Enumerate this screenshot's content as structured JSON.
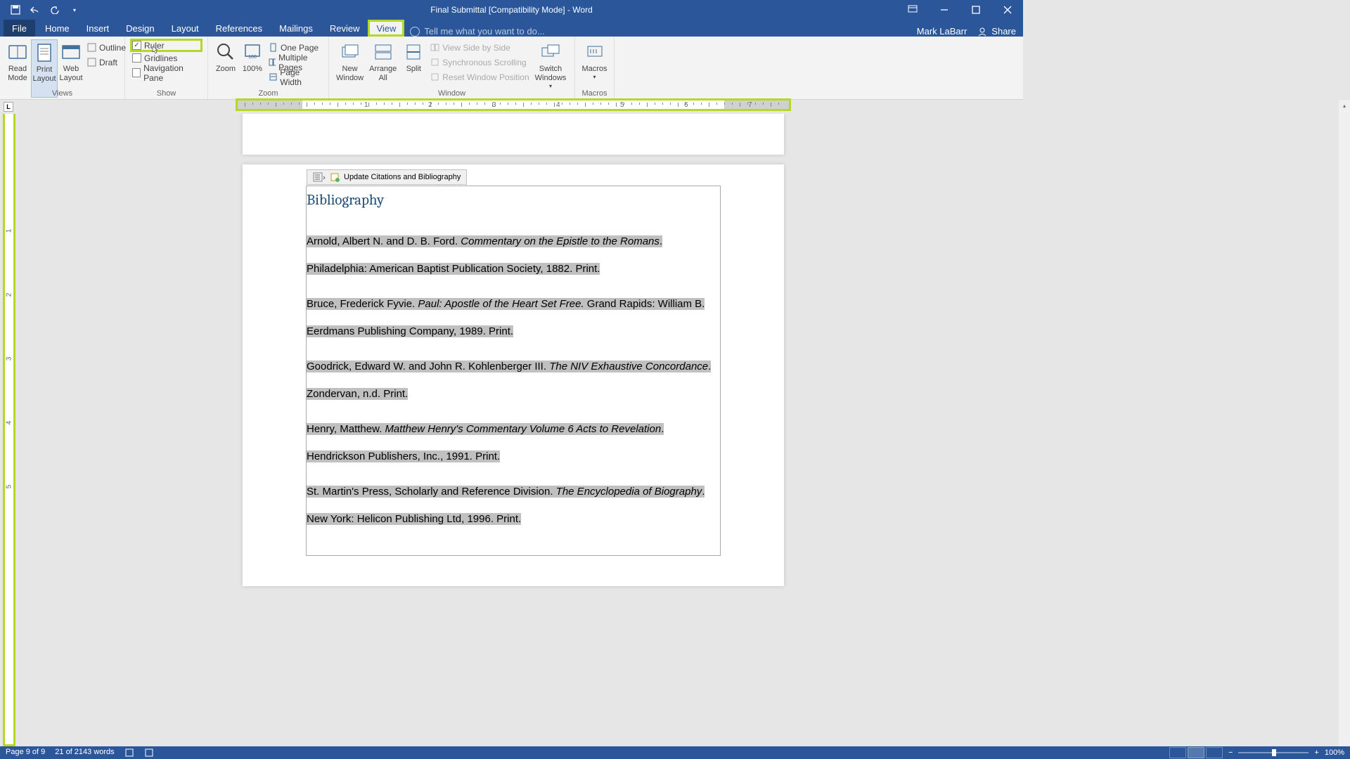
{
  "title_bar": {
    "doc_title": "Final Submittal [Compatibility Mode] - Word"
  },
  "tabs": {
    "file": "File",
    "items": [
      "Home",
      "Insert",
      "Design",
      "Layout",
      "References",
      "Mailings",
      "Review",
      "View"
    ],
    "active": "View",
    "tell_me": "Tell me what you want to do..."
  },
  "user": {
    "name": "Mark LaBarr",
    "share": "Share"
  },
  "ribbon": {
    "views": {
      "label": "Views",
      "read_mode": "Read\nMode",
      "print_layout": "Print\nLayout",
      "web_layout": "Web\nLayout",
      "outline": "Outline",
      "draft": "Draft"
    },
    "show": {
      "label": "Show",
      "ruler": "Ruler",
      "gridlines": "Gridlines",
      "nav_pane": "Navigation Pane"
    },
    "zoom": {
      "label": "Zoom",
      "zoom": "Zoom",
      "pct": "100%",
      "one_page": "One Page",
      "multi_pages": "Multiple Pages",
      "page_width": "Page Width"
    },
    "window": {
      "label": "Window",
      "new_window": "New\nWindow",
      "arrange_all": "Arrange\nAll",
      "split": "Split",
      "side_by_side": "View Side by Side",
      "sync_scroll": "Synchronous Scrolling",
      "reset_pos": "Reset Window Position",
      "switch": "Switch\nWindows"
    },
    "macros": {
      "label": "Macros",
      "macros": "Macros"
    }
  },
  "ruler": {
    "numbers": [
      "1",
      "2",
      "3",
      "4",
      "5",
      "6",
      "7"
    ]
  },
  "document": {
    "update_bar": "Update Citations and Bibliography",
    "bib_title": "Bibliography",
    "entries": [
      {
        "pre": "Arnold, Albert N. and D. B. Ford. ",
        "title": "Commentary on the Epistle to the Romans",
        "post": ". Philadelphia: American Baptist Publication Society, 1882. Print."
      },
      {
        "pre": "Bruce, Frederick Fyvie. ",
        "title": "Paul: Apostle of the Heart Set Free.",
        "post": " Grand Rapids: William B. Eerdmans Publishing Company, 1989. Print."
      },
      {
        "pre": "Goodrick, Edward W. and John R. Kohlenberger III. ",
        "title": "The NIV Exhaustive Concordance",
        "post": ". Zondervan, n.d. Print."
      },
      {
        "pre": "Henry, Matthew. ",
        "title": "Matthew Henry's Commentary Volume 6 Acts to Revelation",
        "post": ". Hendrickson Publishers, Inc., 1991. Print."
      },
      {
        "pre": "St. Martin's Press, Scholarly and Reference Division. ",
        "title": "The Encyclopedia of Biography",
        "post": ". New York: Helicon Publishing Ltd, 1996. Print."
      }
    ]
  },
  "status": {
    "page": "Page 9 of 9",
    "words": "21 of 2143 words",
    "zoom": "100%"
  }
}
